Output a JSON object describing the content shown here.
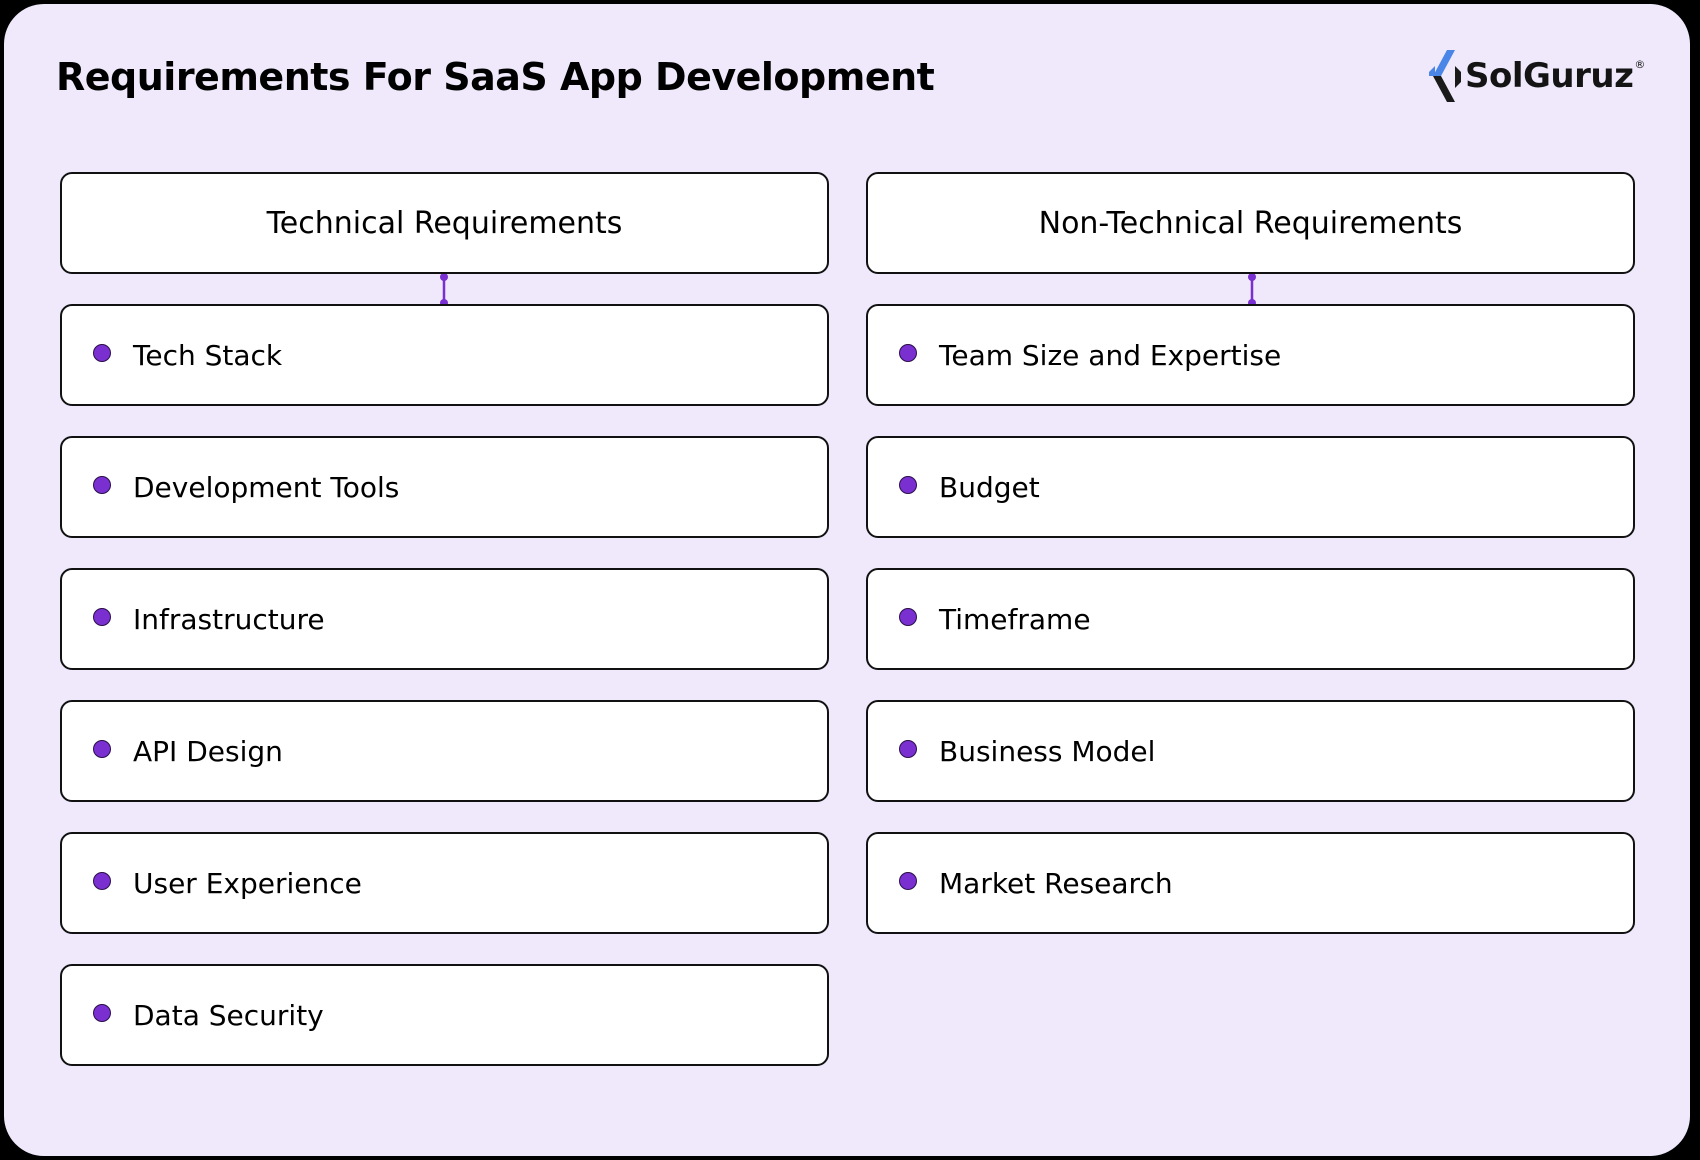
{
  "title": "Requirements For SaaS App Development",
  "logo": {
    "name": "SolGuruz",
    "reg_mark": "®"
  },
  "colors": {
    "background": "#efe9fb",
    "accent": "#7a2fd0",
    "box_border": "#111111"
  },
  "columns": [
    {
      "header": "Technical Requirements",
      "items": [
        "Tech Stack",
        "Development Tools",
        "Infrastructure",
        "API Design",
        "User Experience",
        "Data Security"
      ]
    },
    {
      "header": "Non-Technical Requirements",
      "items": [
        "Team Size and Expertise",
        "Budget",
        "Timeframe",
        "Business Model",
        "Market Research"
      ]
    }
  ]
}
